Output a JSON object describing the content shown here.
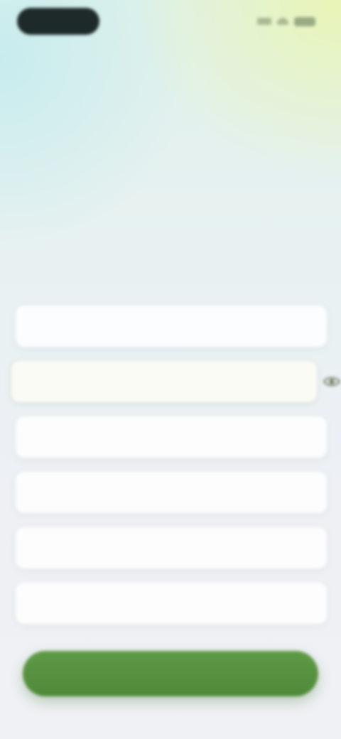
{
  "status_bar": {
    "time": "",
    "icons": [
      "signal-icon",
      "wifi-icon",
      "battery-icon"
    ]
  },
  "header": {
    "title": "",
    "subtitle": ""
  },
  "form": {
    "fields": [
      {
        "label": "",
        "value": "",
        "placeholder": ""
      },
      {
        "label": "",
        "value": "",
        "placeholder": ""
      },
      {
        "label": "",
        "value": "",
        "placeholder": ""
      },
      {
        "label": "",
        "value": "",
        "placeholder": ""
      },
      {
        "label": "",
        "value": "",
        "placeholder": ""
      },
      {
        "label": "",
        "value": "",
        "placeholder": ""
      }
    ],
    "password_toggle_icon": "eye-icon"
  },
  "actions": {
    "submit_label": ""
  },
  "colors": {
    "accent": "#558f3d",
    "title": "#2a3540",
    "status_pill": "#1e2a2a"
  }
}
